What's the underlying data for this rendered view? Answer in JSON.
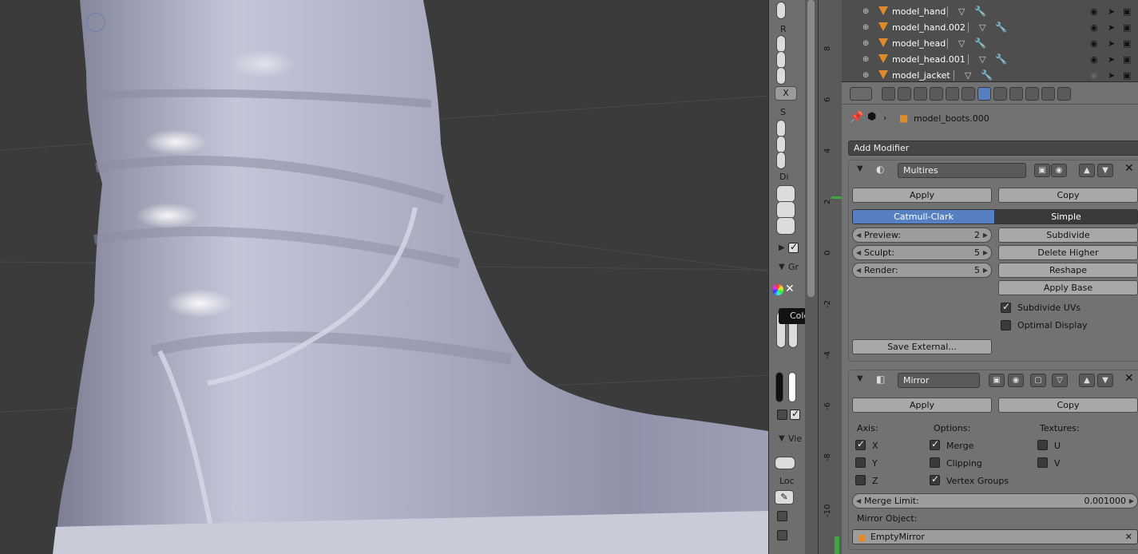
{
  "toolcol": {
    "r_label": "R",
    "x_button": "X",
    "s_label": "S",
    "di_label": "Di",
    "gr_label": "Gr",
    "view_label": "Vie",
    "loc_label": "Loc",
    "tooltip": "Color"
  },
  "ruler": {
    "ticks": [
      "8",
      "6",
      "4",
      "2",
      "0",
      "-2",
      "-4",
      "-6",
      "-8",
      "-10"
    ]
  },
  "outliner": {
    "rows": [
      {
        "name": "model_hand"
      },
      {
        "name": "model_hand.002"
      },
      {
        "name": "model_head"
      },
      {
        "name": "model_head.001"
      },
      {
        "name": "model_jacket"
      }
    ]
  },
  "properties": {
    "object_name": "model_boots.000",
    "add_modifier": "Add Modifier",
    "multires": {
      "name": "Multires",
      "apply": "Apply",
      "copy": "Copy",
      "catmull": "Catmull-Clark",
      "simple": "Simple",
      "preview_label": "Preview:",
      "preview_value": "2",
      "sculpt_label": "Sculpt:",
      "sculpt_value": "5",
      "render_label": "Render:",
      "render_value": "5",
      "subdivide": "Subdivide",
      "delete_higher": "Delete Higher",
      "reshape": "Reshape",
      "apply_base": "Apply Base",
      "subdivide_uvs": "Subdivide UVs",
      "optimal_display": "Optimal Display",
      "save_external": "Save External..."
    },
    "mirror": {
      "name": "Mirror",
      "apply": "Apply",
      "copy": "Copy",
      "axis_label": "Axis:",
      "options_label": "Options:",
      "textures_label": "Textures:",
      "axis_x": "X",
      "axis_y": "Y",
      "axis_z": "Z",
      "merge": "Merge",
      "clipping": "Clipping",
      "vertex_groups": "Vertex Groups",
      "tex_u": "U",
      "tex_v": "V",
      "merge_limit_label": "Merge Limit:",
      "merge_limit_value": "0.001000",
      "mirror_object_label": "Mirror Object:",
      "mirror_object_value": "EmptyMirror"
    }
  },
  "colors": {
    "accent_blue": "#5680c2",
    "outliner_bg": "#4e4e4e",
    "props_bg": "#727272",
    "mesh_orange": "#e08b2a",
    "timeline_green": "#3ea83e"
  }
}
